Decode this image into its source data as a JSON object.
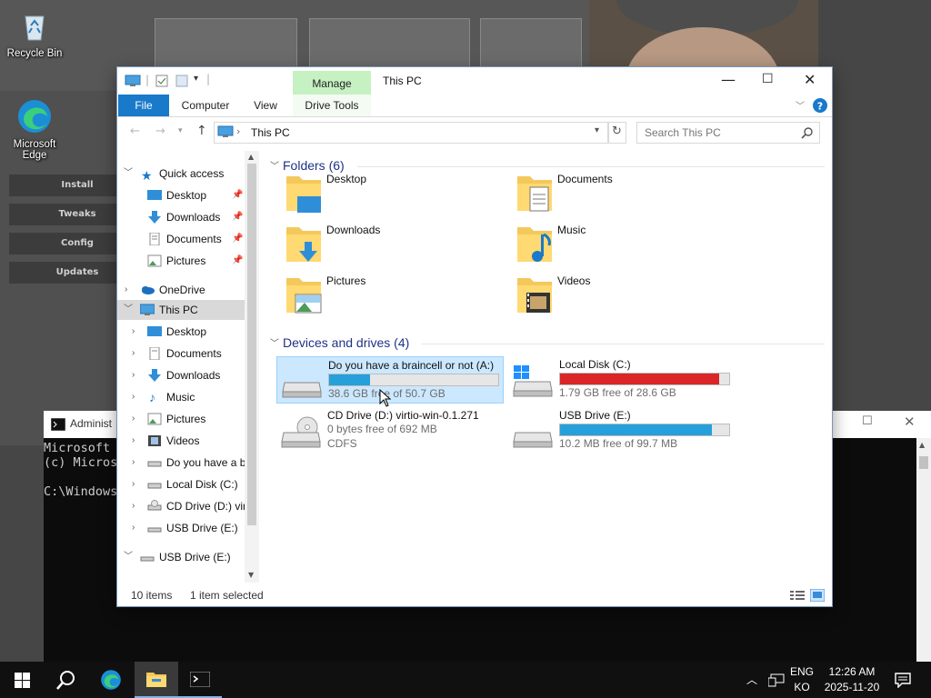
{
  "desktop": {
    "icons": [
      {
        "label": "Recycle Bin",
        "icon": "recycle-bin-icon"
      },
      {
        "label": "Microsoft Edge",
        "icon": "edge-icon"
      }
    ],
    "app_buttons": [
      "Install",
      "Tweaks",
      "Config",
      "Updates"
    ]
  },
  "cmd": {
    "title": "Administ",
    "lines": [
      "Microsoft ",
      "(c) Micros",
      "",
      "C:\\Windows"
    ]
  },
  "explorer": {
    "title": "This PC",
    "qat_icons": [
      "pc-icon",
      "properties-icon",
      "new-folder-icon",
      "customize-dropdown-icon"
    ],
    "tabs": {
      "file": "File",
      "computer": "Computer",
      "view": "View",
      "manage": "Manage",
      "drive_tools": "Drive Tools"
    },
    "address": "This PC",
    "search_placeholder": "Search This PC",
    "nav": {
      "quick_access": "Quick access",
      "qa_items": [
        "Desktop",
        "Downloads",
        "Documents",
        "Pictures"
      ],
      "onedrive": "OneDrive",
      "this_pc": "This PC",
      "pc_items": [
        "Desktop",
        "Documents",
        "Downloads",
        "Music",
        "Pictures",
        "Videos",
        "Do you have a b",
        "Local Disk (C:)",
        "CD Drive (D:) virt",
        "USB Drive (E:)"
      ],
      "usb": "USB Drive (E:)"
    },
    "groups": {
      "folders": "Folders (6)",
      "drives": "Devices and drives (4)"
    },
    "folders": [
      "Desktop",
      "Documents",
      "Downloads",
      "Music",
      "Pictures",
      "Videos"
    ],
    "drives": [
      {
        "name": "Do you have a braincell or not (A:)",
        "free": "38.6 GB free of 50.7 GB",
        "used_fraction": 0.24,
        "color": "#26a0da"
      },
      {
        "name": "Local Disk (C:)",
        "free": "1.79 GB free of 28.6 GB",
        "used_fraction": 0.94,
        "color": "#da2626"
      },
      {
        "name": "CD Drive (D:) virtio-win-0.1.271",
        "free": "0 bytes free of 692 MB",
        "fs": "CDFS"
      },
      {
        "name": "USB Drive (E:)",
        "free": "10.2 MB free of 99.7 MB",
        "used_fraction": 0.9,
        "color": "#26a0da"
      }
    ],
    "status": {
      "items": "10 items",
      "selected": "1 item selected"
    }
  },
  "taskbar": {
    "lang_top": "ENG",
    "lang_bottom": "KO",
    "time": "12:26 AM",
    "date": "2025-11-20"
  }
}
